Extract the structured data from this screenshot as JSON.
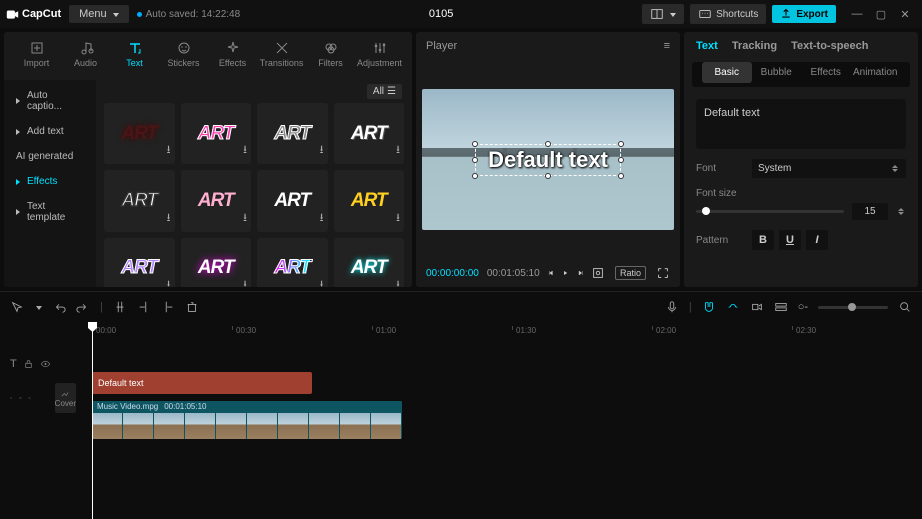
{
  "app": {
    "name": "CapCut",
    "title": "0105",
    "autosave": "Auto saved: 14:22:48"
  },
  "toolbar": {
    "menu": "Menu",
    "shortcuts": "Shortcuts",
    "export": "Export"
  },
  "topTabs": {
    "import": "Import",
    "audio": "Audio",
    "text": "Text",
    "stickers": "Stickers",
    "effects": "Effects",
    "transitions": "Transitions",
    "filters": "Filters",
    "adjustment": "Adjustment"
  },
  "sidebar": {
    "items": [
      "Auto captio...",
      "Add text",
      "AI generated",
      "Effects",
      "Text template"
    ]
  },
  "content": {
    "all": "All",
    "artLabel": "ART"
  },
  "player": {
    "label": "Player",
    "overlay": "Default text",
    "tc_cur": "00:00:00:00",
    "tc_dur": "00:01:05:10",
    "ratio": "Ratio"
  },
  "inspector": {
    "tabs": {
      "text": "Text",
      "tracking": "Tracking",
      "tts": "Text-to-speech"
    },
    "subtabs": {
      "basic": "Basic",
      "bubble": "Bubble",
      "effects": "Effects",
      "animation": "Animation"
    },
    "textVal": "Default text",
    "fontLbl": "Font",
    "fontVal": "System",
    "sizeLbl": "Font size",
    "sizeVal": "15",
    "patternLbl": "Pattern"
  },
  "timeline": {
    "ticks": [
      "00:00",
      "00:30",
      "01:00",
      "01:30",
      "02:00",
      "02:30"
    ],
    "textClip": "Default text",
    "vidClip": {
      "name": "Music Video.mpg",
      "dur": "00:01:05:10"
    },
    "cover": "Cover"
  }
}
